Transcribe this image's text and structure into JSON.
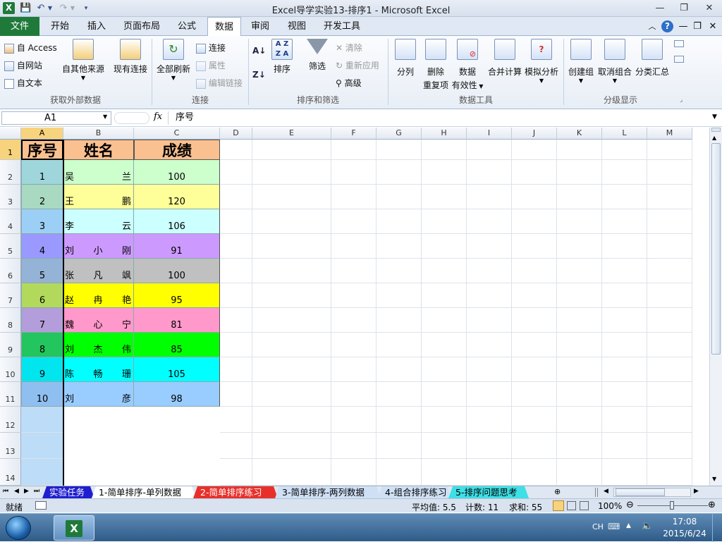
{
  "window": {
    "title": "Excel导学实验13-排序1  -  Microsoft Excel"
  },
  "tabs": {
    "file": "文件",
    "home": "开始",
    "insert": "插入",
    "layout": "页面布局",
    "formulas": "公式",
    "data": "数据",
    "review": "审阅",
    "view": "视图",
    "developer": "开发工具"
  },
  "ribbon": {
    "external": {
      "access": "自 Access",
      "web": "自网站",
      "text": "自文本",
      "other": "自其他来源",
      "existing": "现有连接",
      "group": "获取外部数据"
    },
    "connections": {
      "refresh_all": "全部刷新",
      "connections": "连接",
      "properties": "属性",
      "edit_links": "编辑链接",
      "group": "连接"
    },
    "sort": {
      "sort": "排序",
      "filter": "筛选",
      "clear": "清除",
      "reapply": "重新应用",
      "advanced": "高级",
      "group": "排序和筛选"
    },
    "tools": {
      "text_to_columns": "分列",
      "remove_dup_1": "删除",
      "remove_dup_2": "重复项",
      "validation_1": "数据",
      "validation_2": "有效性",
      "consolidate": "合并计算",
      "what_if": "模拟分析",
      "group": "数据工具"
    },
    "outline": {
      "group_btn": "创建组",
      "ungroup": "取消组合",
      "subtotal": "分类汇总",
      "group": "分级显示"
    }
  },
  "formula_bar": {
    "name_box": "A1",
    "fx": "fx",
    "value": "序号"
  },
  "columns": [
    "A",
    "B",
    "C",
    "D",
    "E",
    "F",
    "G",
    "H",
    "I",
    "J",
    "K",
    "L",
    "M"
  ],
  "rows": [
    "1",
    "2",
    "3",
    "4",
    "5",
    "6",
    "7",
    "8",
    "9",
    "10",
    "11",
    "12",
    "13",
    "14"
  ],
  "table": {
    "headers": [
      "序号",
      "姓名",
      "成绩"
    ],
    "records": [
      {
        "no": "1",
        "first": "吴",
        "mid": "",
        "last": "兰",
        "score": "100",
        "c_no": "#9fd6dc",
        "c_name": "#ccffcc",
        "c_score": "#ccffcc"
      },
      {
        "no": "2",
        "first": "王",
        "mid": "",
        "last": "鹏",
        "score": "120",
        "c_no": "#a9d9c0",
        "c_name": "#ffff99",
        "c_score": "#ffff99"
      },
      {
        "no": "3",
        "first": "李",
        "mid": "",
        "last": "云",
        "score": "106",
        "c_no": "#9ccff5",
        "c_name": "#ccffff",
        "c_score": "#ccffff"
      },
      {
        "no": "4",
        "first": "刘",
        "mid": "小",
        "last": "刚",
        "score": "91",
        "c_no": "#9999ff",
        "c_name": "#cc99ff",
        "c_score": "#cc99ff"
      },
      {
        "no": "5",
        "first": "张",
        "mid": "凡",
        "last": "飒",
        "score": "100",
        "c_no": "#94b3d6",
        "c_name": "#c0c0c0",
        "c_score": "#c0c0c0"
      },
      {
        "no": "6",
        "first": "赵",
        "mid": "冉",
        "last": "艳",
        "score": "95",
        "c_no": "#b3d95c",
        "c_name": "#ffff00",
        "c_score": "#ffff00"
      },
      {
        "no": "7",
        "first": "魏",
        "mid": "心",
        "last": "宁",
        "score": "81",
        "c_no": "#b39ddb",
        "c_name": "#ff99cc",
        "c_score": "#ff99cc"
      },
      {
        "no": "8",
        "first": "刘",
        "mid": "杰",
        "last": "伟",
        "score": "85",
        "c_no": "#22c55e",
        "c_name": "#00ff00",
        "c_score": "#00ff00"
      },
      {
        "no": "9",
        "first": "陈",
        "mid": "畅",
        "last": "珊",
        "score": "105",
        "c_no": "#00e5ee",
        "c_name": "#00ffff",
        "c_score": "#00ffff"
      },
      {
        "no": "10",
        "first": "刘",
        "mid": "",
        "last": "彦",
        "score": "98",
        "c_no": "#8fbff0",
        "c_name": "#99ccff",
        "c_score": "#99ccff"
      }
    ],
    "header_colors": {
      "no": "#fbc08f",
      "name": "#fbc08f",
      "score": "#fbc08f"
    },
    "extra_a_color": "#bcdcf7"
  },
  "sheets": [
    {
      "label": "实验任务",
      "bg": "#1f1fcf",
      "fg": "#ffffff"
    },
    {
      "label": "1-简单排序-单列数据",
      "bg": "#ffffff",
      "fg": "#000000"
    },
    {
      "label": "2-简单排序练习",
      "bg": "#e8302a",
      "fg": "#ffffff"
    },
    {
      "label": "3-简单排序-两列数据",
      "bg": "#cfe0f5",
      "fg": "#000000"
    },
    {
      "label": "4-组合排序练习",
      "bg": "#cfe0f5",
      "fg": "#000000"
    },
    {
      "label": "5-排序问题思考",
      "bg": "#3de0e6",
      "fg": "#000000"
    }
  ],
  "status": {
    "ready": "就绪",
    "average": "平均值: 5.5",
    "count": "计数: 11",
    "sum": "求和: 55",
    "zoom": "100%"
  },
  "taskbar": {
    "lang": "CH",
    "time": "17:08",
    "date": "2015/6/24"
  }
}
